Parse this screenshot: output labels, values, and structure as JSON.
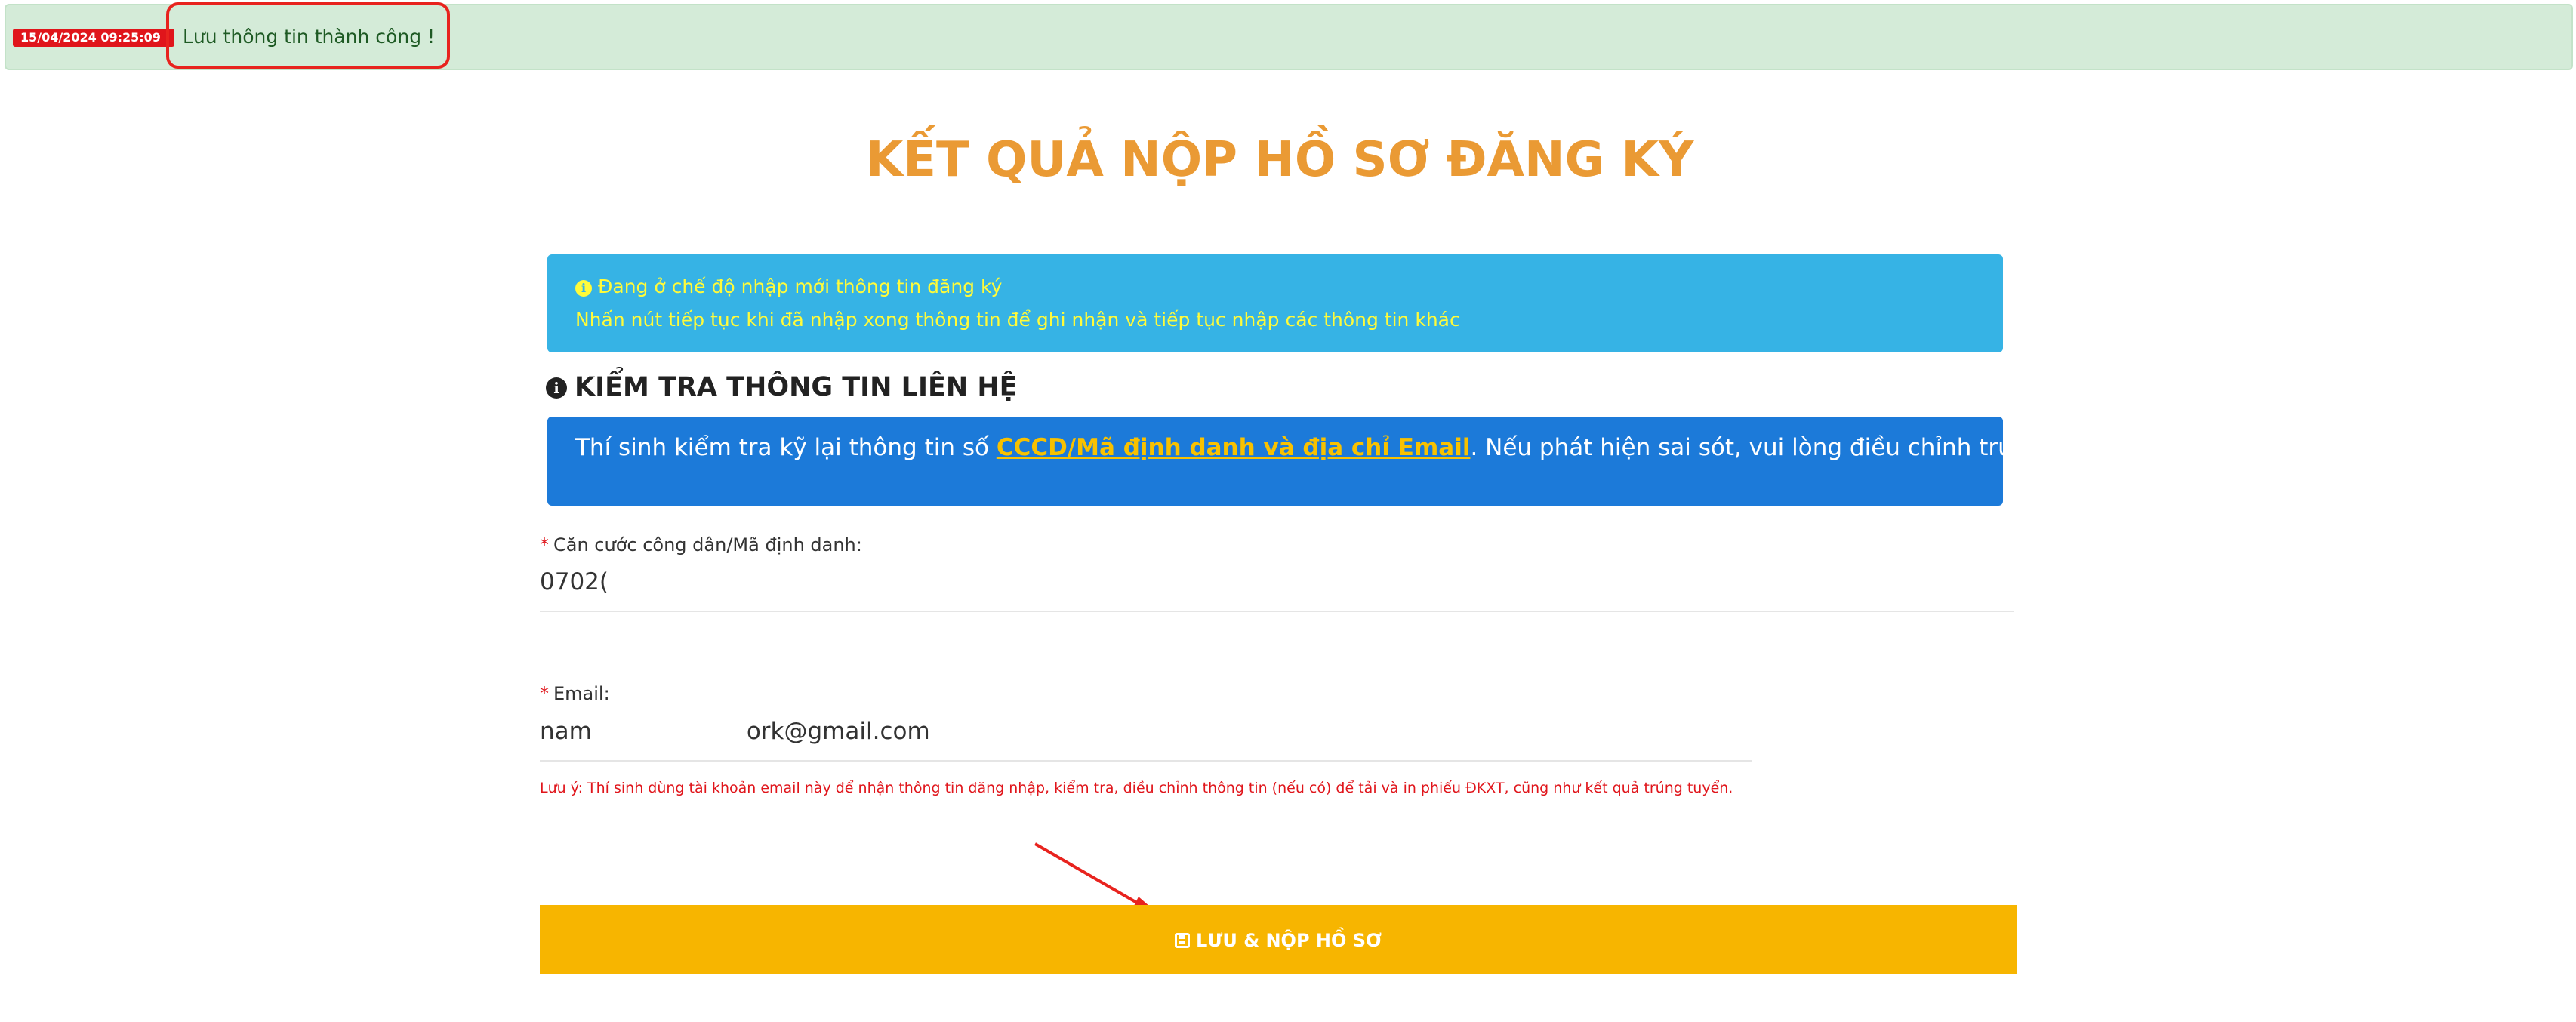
{
  "notification": {
    "timestamp": "15/04/2024 09:25:09",
    "message": "Lưu thông tin thành công !"
  },
  "page": {
    "title": "KẾT QUẢ NỘP HỒ SƠ ĐĂNG KÝ"
  },
  "info_box": {
    "line1": "Đang ở chế độ nhập mới thông tin đăng ký",
    "line2": "Nhấn nút tiếp tục khi đã nhập xong thông tin để ghi nhận và tiếp tục nhập các thông tin khác",
    "icon": "info-circle-icon"
  },
  "section": {
    "heading": "KIỂM TRA THÔNG TIN LIÊN HỆ",
    "icon": "info-circle-icon"
  },
  "notice": {
    "text_before": "Thí sinh kiểm tra kỹ lại thông tin số ",
    "link_text": "CCCD/Mã định danh và địa chỉ Email",
    "text_after": ". Nếu phát hiện sai sót, vui lòng điều chỉnh trực tiếp ở bên dưới."
  },
  "form": {
    "required_marker": "*",
    "id_field": {
      "label": "Căn cước công dân/Mã định danh:",
      "value": "0702("
    },
    "email_field": {
      "label": "Email:",
      "value_start": "nam",
      "value_end": "ork@gmail.com"
    },
    "note": "Lưu ý: Thí sinh dùng tài khoản email này để nhận thông tin đăng nhập, kiểm tra, điều chỉnh thông tin (nếu có) để tải và in phiếu ĐKXT, cũng như kết quả trúng tuyển."
  },
  "submit": {
    "label": "LƯU & NỘP HỒ SƠ",
    "icon": "floppy-disk-icon"
  },
  "colors": {
    "title_orange": "#ea9a34",
    "info_blue": "#36b3e5",
    "notice_blue": "#1c7ad9",
    "button_yellow": "#f7b500",
    "success_green_bg": "#d4ebd8",
    "error_red": "#e0151b"
  }
}
